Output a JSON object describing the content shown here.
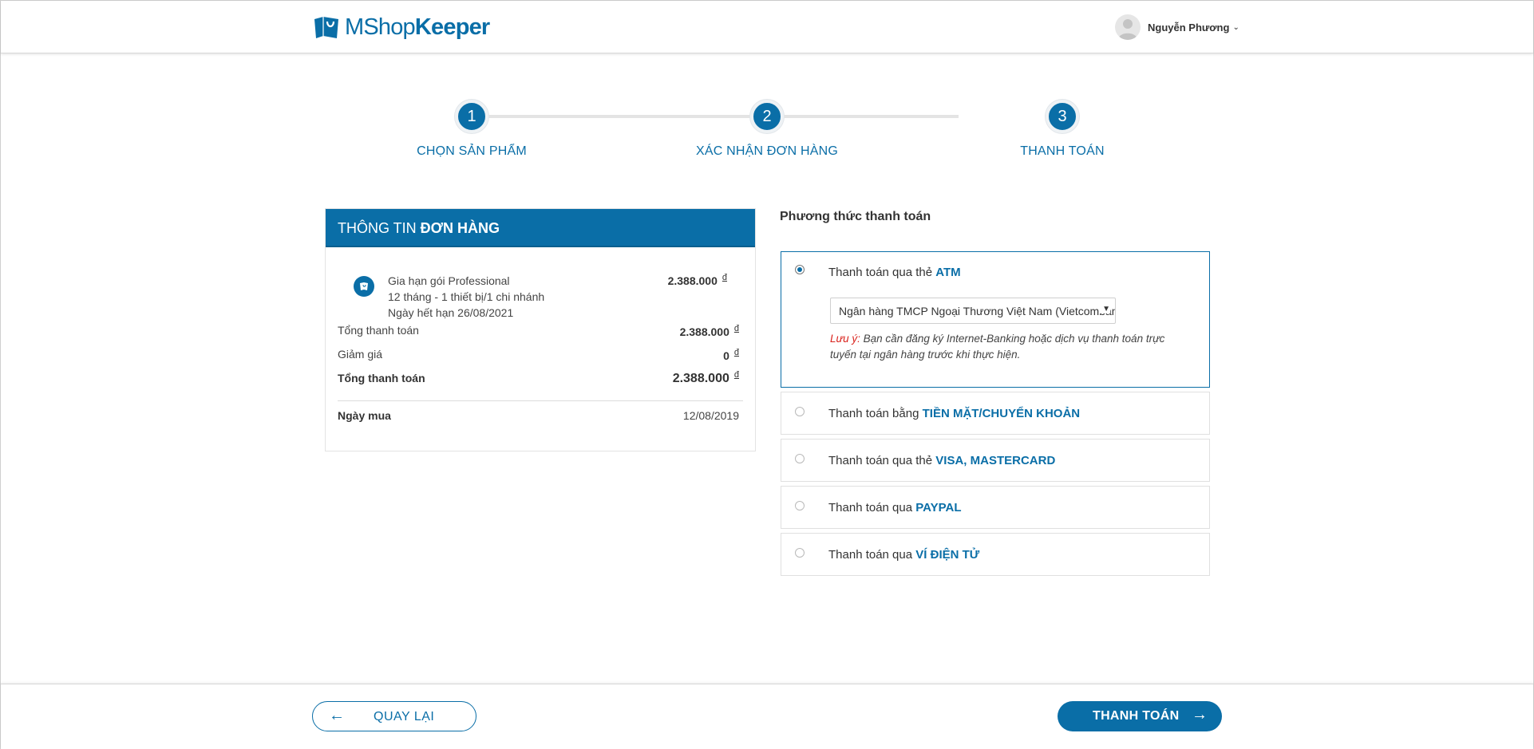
{
  "header": {
    "logo_text_light": "MShop",
    "logo_text_bold": "Keeper",
    "user_name": "Nguyễn Phương"
  },
  "stepper": {
    "steps": [
      {
        "number": "1",
        "label": "CHỌN SẢN PHẨM"
      },
      {
        "number": "2",
        "label": "XÁC NHẬN ĐƠN HÀNG"
      },
      {
        "number": "3",
        "label": "THANH TOÁN"
      }
    ],
    "current_step": 3
  },
  "order": {
    "title_light": "THÔNG TIN ",
    "title_bold": "ĐƠN HÀNG",
    "product": {
      "name": "Gia hạn gói Professional",
      "detail": "12 tháng - 1 thiết bị/1 chi nhánh",
      "expiry": "Ngày hết hạn 26/08/2021",
      "price": "2.388.000",
      "currency": "đ"
    },
    "rows": {
      "subtotal_label": "Tổng thanh toán",
      "subtotal_value": "2.388.000",
      "discount_label": "Giảm giá",
      "discount_value": "0",
      "total_label": "Tổng thanh toán",
      "total_value": "2.388.000",
      "currency": "đ",
      "date_label": "Ngày mua",
      "date_value": "12/08/2019"
    }
  },
  "payment": {
    "title": "Phương thức thanh toán",
    "options": [
      {
        "prefix": "Thanh toán qua thẻ ",
        "highlight": "ATM",
        "selected": true
      },
      {
        "prefix": "Thanh toán bằng ",
        "highlight": "TIỀN MẶT/CHUYỂN KHOẢN",
        "selected": false
      },
      {
        "prefix": "Thanh toán qua thẻ ",
        "highlight": "VISA, MASTERCARD",
        "selected": false
      },
      {
        "prefix": "Thanh toán qua ",
        "highlight": "PAYPAL",
        "selected": false
      },
      {
        "prefix": "Thanh toán qua ",
        "highlight": "VÍ ĐIỆN TỬ",
        "selected": false
      }
    ],
    "bank_selected": "Ngân hàng TMCP Ngoại Thương Việt Nam (Vietcombanl",
    "note_warn": "Lưu ý:",
    "note_text": " Bạn cần đăng ký Internet-Banking hoặc dịch vụ thanh toán trực tuyến tại ngân hàng trước khi thực hiện."
  },
  "footer": {
    "back_label": "QUAY LẠI",
    "pay_label": "THANH TOÁN"
  },
  "colors": {
    "brand": "#0a6ea7",
    "warning": "#d9221c"
  }
}
